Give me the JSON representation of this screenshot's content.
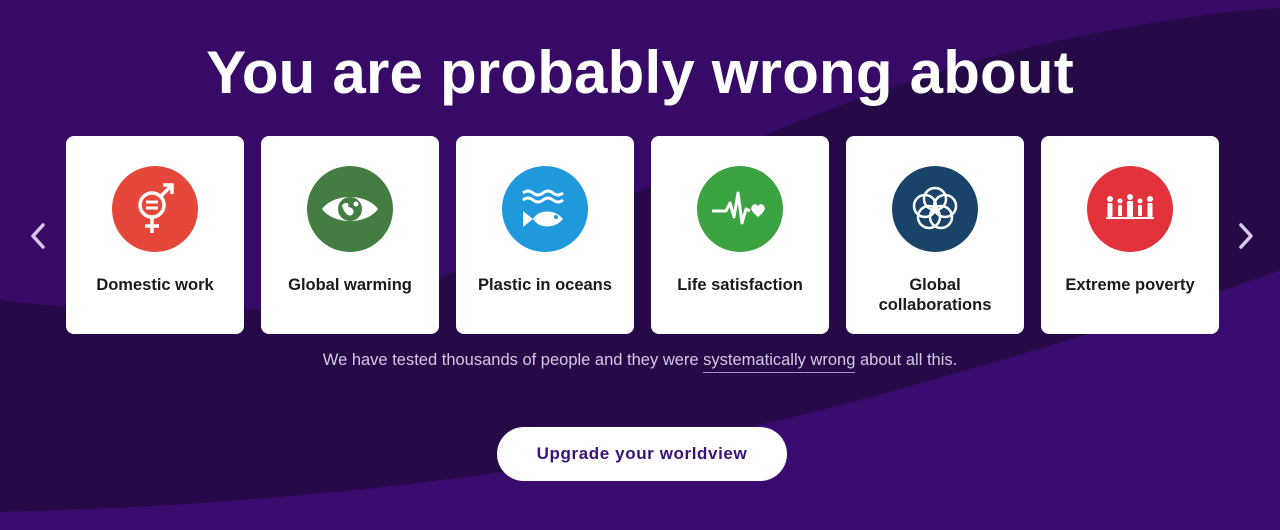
{
  "hero": {
    "title": "You are probably wrong about",
    "subtitle_before": "We have tested thousands of people and they were ",
    "subtitle_link": "systematically wrong",
    "subtitle_after": " about all this.",
    "cta_label": "Upgrade your worldview"
  },
  "colors": {
    "background": "#380a68",
    "background_dark": "#240a46",
    "card": "#ffffff"
  },
  "cards": [
    {
      "label": "Domestic work",
      "icon": "gender-equality-icon",
      "color": "#e5473a"
    },
    {
      "label": "Global warming",
      "icon": "eye-globe-icon",
      "color": "#437d41"
    },
    {
      "label": "Plastic in oceans",
      "icon": "fish-waves-icon",
      "color": "#1f99dc"
    },
    {
      "label": "Life satisfaction",
      "icon": "heartbeat-icon",
      "color": "#3ba342"
    },
    {
      "label": "Global collaborations",
      "icon": "interlinked-rings-icon",
      "color": "#1a4369"
    },
    {
      "label": "Extreme poverty",
      "icon": "family-icon",
      "color": "#e3323b"
    }
  ],
  "navigation": {
    "prev_icon": "chevron-left-icon",
    "next_icon": "chevron-right-icon"
  }
}
